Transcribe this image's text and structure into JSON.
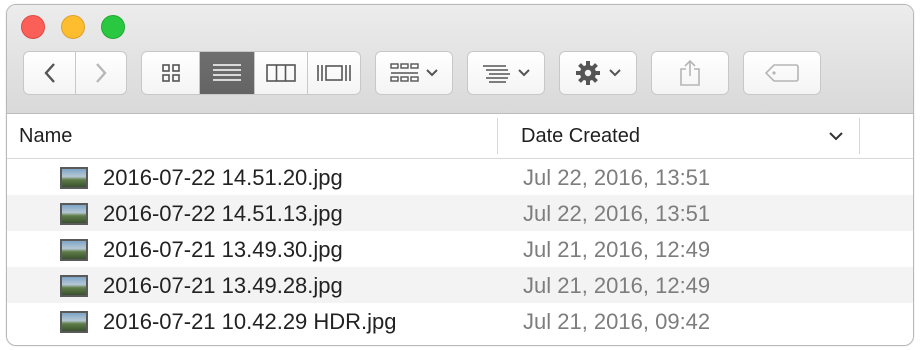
{
  "window": {
    "traffic_lights": [
      "close",
      "minimize",
      "zoom"
    ]
  },
  "toolbar": {
    "icons": {
      "back": "chevron-left-icon",
      "forward": "chevron-right-icon",
      "icon_view": "grid-icon",
      "list_view": "list-icon",
      "column_view": "columns-icon",
      "coverflow_view": "coverflow-icon",
      "group": "group-icon",
      "arrange": "arrange-icon",
      "action": "gear-icon",
      "share": "share-icon",
      "tags": "tag-icon"
    },
    "active_view": "list"
  },
  "columns": {
    "name": "Name",
    "date_created": "Date Created"
  },
  "files": [
    {
      "name": "2016-07-22 14.51.20.jpg",
      "date": "Jul 22, 2016, 13:51"
    },
    {
      "name": "2016-07-22 14.51.13.jpg",
      "date": "Jul 22, 2016, 13:51"
    },
    {
      "name": "2016-07-21 13.49.30.jpg",
      "date": "Jul 21, 2016, 12:49"
    },
    {
      "name": "2016-07-21 13.49.28.jpg",
      "date": "Jul 21, 2016, 12:49"
    },
    {
      "name": "2016-07-21 10.42.29 HDR.jpg",
      "date": "Jul 21, 2016, 09:42"
    }
  ],
  "colors": {
    "active_segment": "#666666",
    "close": "#fc5f57",
    "minimize": "#fdbd2f",
    "zoom": "#2ac840"
  }
}
